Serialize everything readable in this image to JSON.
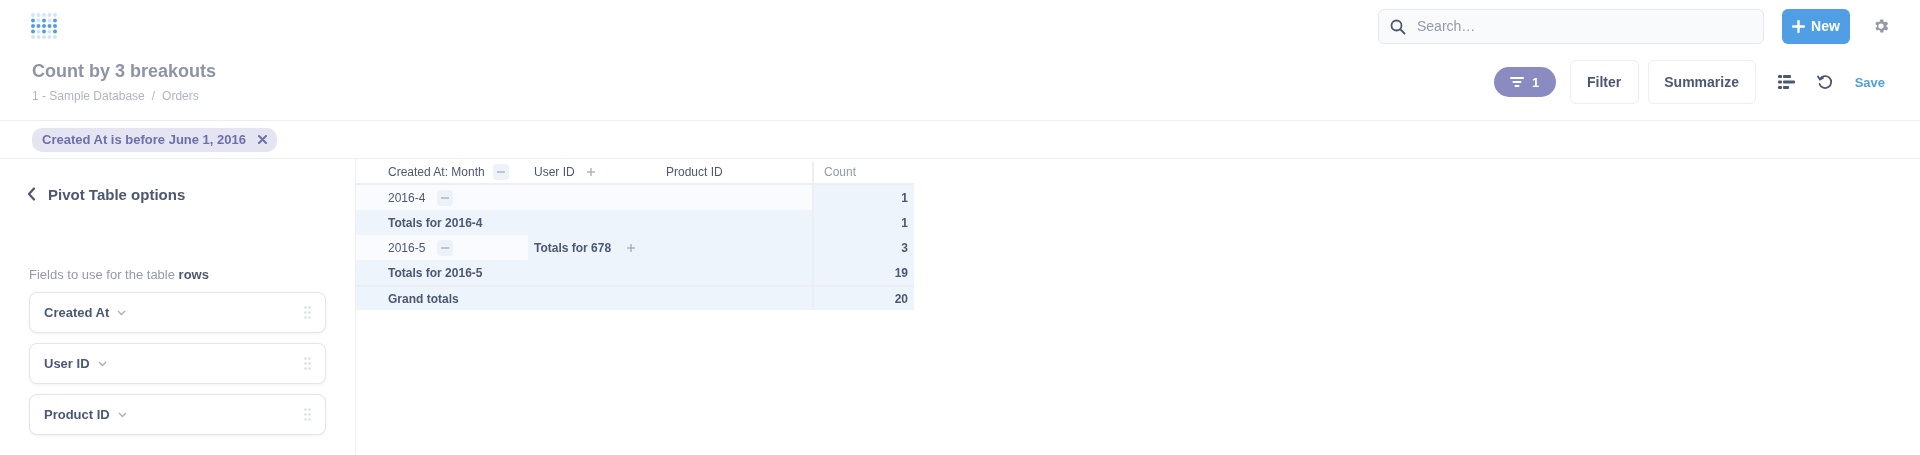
{
  "header": {
    "search": {
      "placeholder": "Search…"
    },
    "new_button": "New"
  },
  "question": {
    "title": "Count by 3 breakouts",
    "breadcrumb": [
      "1 - Sample Database",
      "Orders"
    ],
    "breadcrumb_separator": "/"
  },
  "toolbar": {
    "filter_count": "1",
    "buttons": [
      "Filter",
      "Summarize"
    ],
    "save": "Save"
  },
  "filters": [
    {
      "label": "Created At is before June 1, 2016"
    }
  ],
  "sidebar": {
    "title": "Pivot Table options",
    "section_label": "Fields to use for the table **rows**",
    "fields": [
      "Created At",
      "User ID",
      "Product ID"
    ]
  },
  "pivot": {
    "columns": [
      {
        "label": "Created At: Month",
        "expanded": true
      },
      {
        "label": "User ID",
        "expanded": false
      },
      {
        "label": "Product ID"
      }
    ],
    "value_column": "Count",
    "rows": [
      {
        "kind": "data",
        "cells": [
          {
            "text": "2016-4",
            "kind": "value",
            "expanded": true
          }
        ],
        "count": "1"
      },
      {
        "kind": "total",
        "cells": [
          {
            "text": "Totals for 2016-4",
            "kind": "subtotal"
          }
        ],
        "count": "1"
      },
      {
        "kind": "data",
        "cells": [
          {
            "text": "2016-5",
            "kind": "value",
            "expanded": true
          },
          {
            "text": "Totals for 678",
            "kind": "subtotal",
            "expanded": false
          }
        ],
        "count": "3"
      },
      {
        "kind": "total",
        "cells": [
          {
            "text": "Totals for 2016-5",
            "kind": "subtotal"
          }
        ],
        "count": "19"
      },
      {
        "kind": "grand",
        "cells": [
          {
            "text": "Grand totals",
            "kind": "subtotal"
          }
        ],
        "count": "20"
      }
    ]
  }
}
